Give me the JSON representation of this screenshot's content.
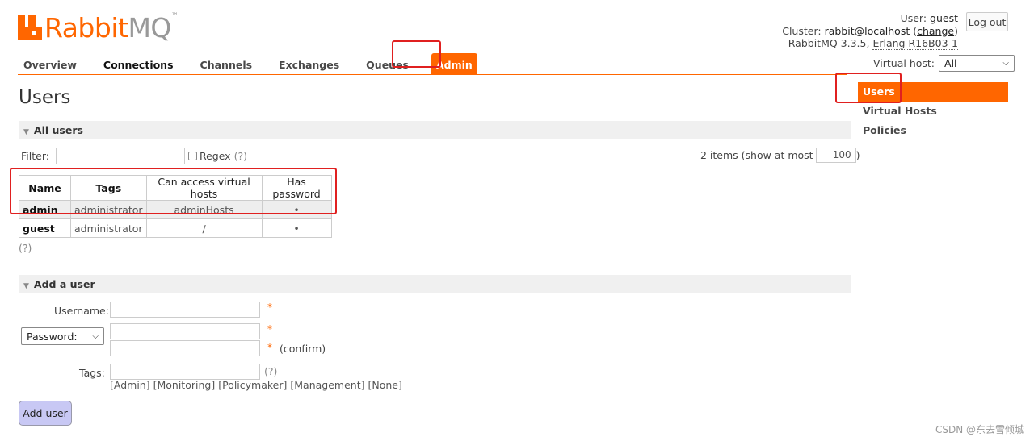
{
  "logo": {
    "rabbit": "Rabbit",
    "mq": "MQ",
    "tm": "™"
  },
  "header": {
    "user_label": "User:",
    "user_value": "guest",
    "logout_label": "Log out",
    "cluster_label": "Cluster:",
    "cluster_value": "rabbit@localhost",
    "change_label": "change",
    "version_text": "RabbitMQ 3.3.5,",
    "erlang_text": "Erlang R16B03-1",
    "vhost_label": "Virtual host:",
    "vhost_value": "All"
  },
  "tabs": [
    {
      "label": "Overview"
    },
    {
      "label": "Connections"
    },
    {
      "label": "Channels"
    },
    {
      "label": "Exchanges"
    },
    {
      "label": "Queues"
    },
    {
      "label": "Admin"
    }
  ],
  "sidenav": [
    {
      "label": "Users"
    },
    {
      "label": "Virtual Hosts"
    },
    {
      "label": "Policies"
    }
  ],
  "page_title": "Users",
  "all_users": {
    "section_title": "All users",
    "filter_label": "Filter:",
    "regex_label": "Regex",
    "help": "(?)",
    "items_text": "2 items (show at most",
    "items_max": "100",
    "items_close": ")",
    "columns": [
      "Name",
      "Tags",
      "Can access virtual hosts",
      "Has password"
    ],
    "rows": [
      {
        "name": "admin",
        "tags": "administrator",
        "vhosts": "adminHosts",
        "has_password": "•"
      },
      {
        "name": "guest",
        "tags": "administrator",
        "vhosts": "/",
        "has_password": "•"
      }
    ],
    "help_below": "(?)"
  },
  "add_user": {
    "section_title": "Add a user",
    "username_label": "Username:",
    "password_select": "Password:",
    "confirm_label": "(confirm)",
    "tags_label": "Tags:",
    "tags_help": "(?)",
    "tag_options": [
      "[Admin]",
      "[Monitoring]",
      "[Policymaker]",
      "[Management]",
      "[None]"
    ],
    "required_mark": "*",
    "submit_label": "Add user"
  },
  "watermark": "CSDN @东去雪倾城",
  "colors": {
    "accent": "#ff6600",
    "annotation": "#e02020",
    "button": "#c8c8f4"
  }
}
